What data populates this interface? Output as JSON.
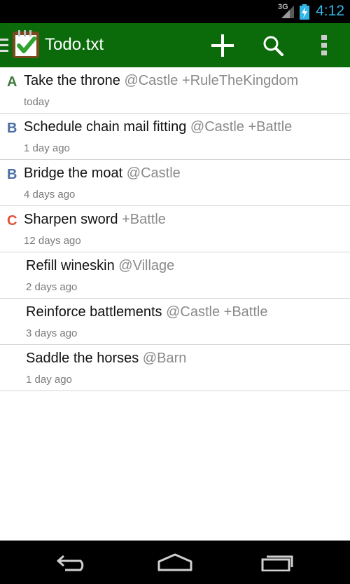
{
  "status_bar": {
    "network": "3G",
    "time": "4:12"
  },
  "action_bar": {
    "title": "Todo.txt",
    "background": "#0b6b0b",
    "actions": [
      {
        "name": "add-icon"
      },
      {
        "name": "search-icon"
      },
      {
        "name": "overflow-menu-icon"
      }
    ]
  },
  "priority_colors": {
    "A": "#3d7a3d",
    "B": "#4a6fa5",
    "C": "#e0523a"
  },
  "tasks": [
    {
      "priority": "A",
      "text": "Take the throne",
      "tags": "@Castle +RuleTheKingdom",
      "age": "today"
    },
    {
      "priority": "B",
      "text": "Schedule chain mail fitting",
      "tags": "@Castle +Battle",
      "age": "1 day ago"
    },
    {
      "priority": "B",
      "text": "Bridge the moat",
      "tags": "@Castle",
      "age": "4 days ago"
    },
    {
      "priority": "C",
      "text": "Sharpen sword",
      "tags": "+Battle",
      "age": "12 days ago"
    },
    {
      "priority": "",
      "text": "Refill wineskin",
      "tags": "@Village",
      "age": "2 days ago"
    },
    {
      "priority": "",
      "text": "Reinforce battlements",
      "tags": "@Castle +Battle",
      "age": "3 days ago"
    },
    {
      "priority": "",
      "text": "Saddle the horses",
      "tags": "@Barn",
      "age": "1 day ago"
    }
  ],
  "nav_bar": [
    {
      "name": "back-icon"
    },
    {
      "name": "home-icon"
    },
    {
      "name": "recent-apps-icon"
    }
  ]
}
